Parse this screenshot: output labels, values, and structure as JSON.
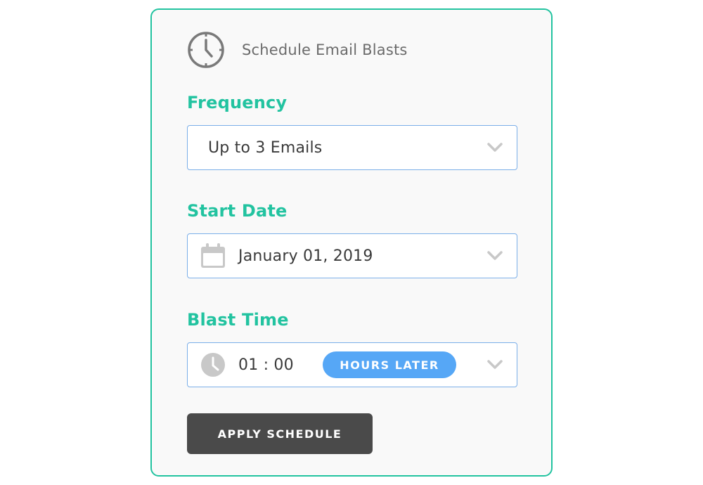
{
  "header": {
    "title": "Schedule Email Blasts",
    "icon": "clock-icon"
  },
  "frequency": {
    "label": "Frequency",
    "value": "Up to 3 Emails"
  },
  "start_date": {
    "label": "Start Date",
    "value": "January 01, 2019",
    "icon": "calendar-icon"
  },
  "blast_time": {
    "label": "Blast Time",
    "value": "01 : 00",
    "badge": "HOURS LATER",
    "icon": "clock-icon"
  },
  "apply_button": {
    "label": "APPLY SCHEDULE"
  },
  "colors": {
    "accent": "#22c3a0",
    "select_border": "#7aaee8",
    "badge": "#56a7f6",
    "button": "#4a4a4a",
    "chevron": "#c8c8c8"
  }
}
